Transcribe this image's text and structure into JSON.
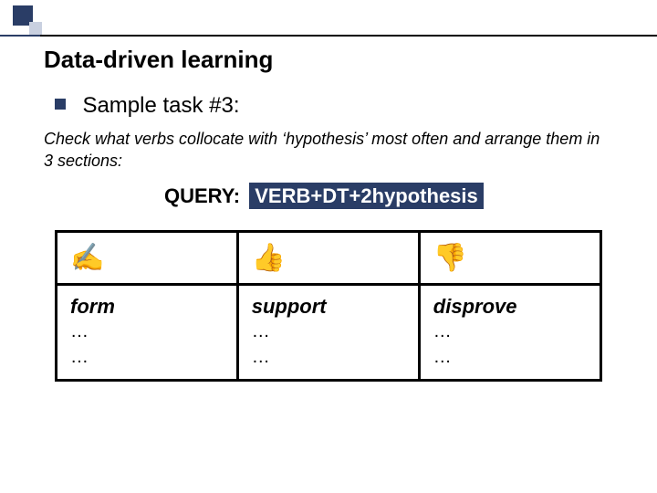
{
  "title": "Data-driven learning",
  "bullet1": "Sample task #3:",
  "instruction": "Check what verbs collocate with ‘hypothesis’ most often and arrange them in 3 sections:",
  "query_label": "QUERY:",
  "query_value": "VERB+DT+2hypothesis",
  "table": {
    "cols": [
      {
        "icon": "✍",
        "word": "form",
        "r1": "…",
        "r2": "…"
      },
      {
        "icon": "👍",
        "word": "support",
        "r1": "…",
        "r2": "…"
      },
      {
        "icon": "👎",
        "word": "disprove",
        "r1": "…",
        "r2": "…"
      }
    ]
  }
}
